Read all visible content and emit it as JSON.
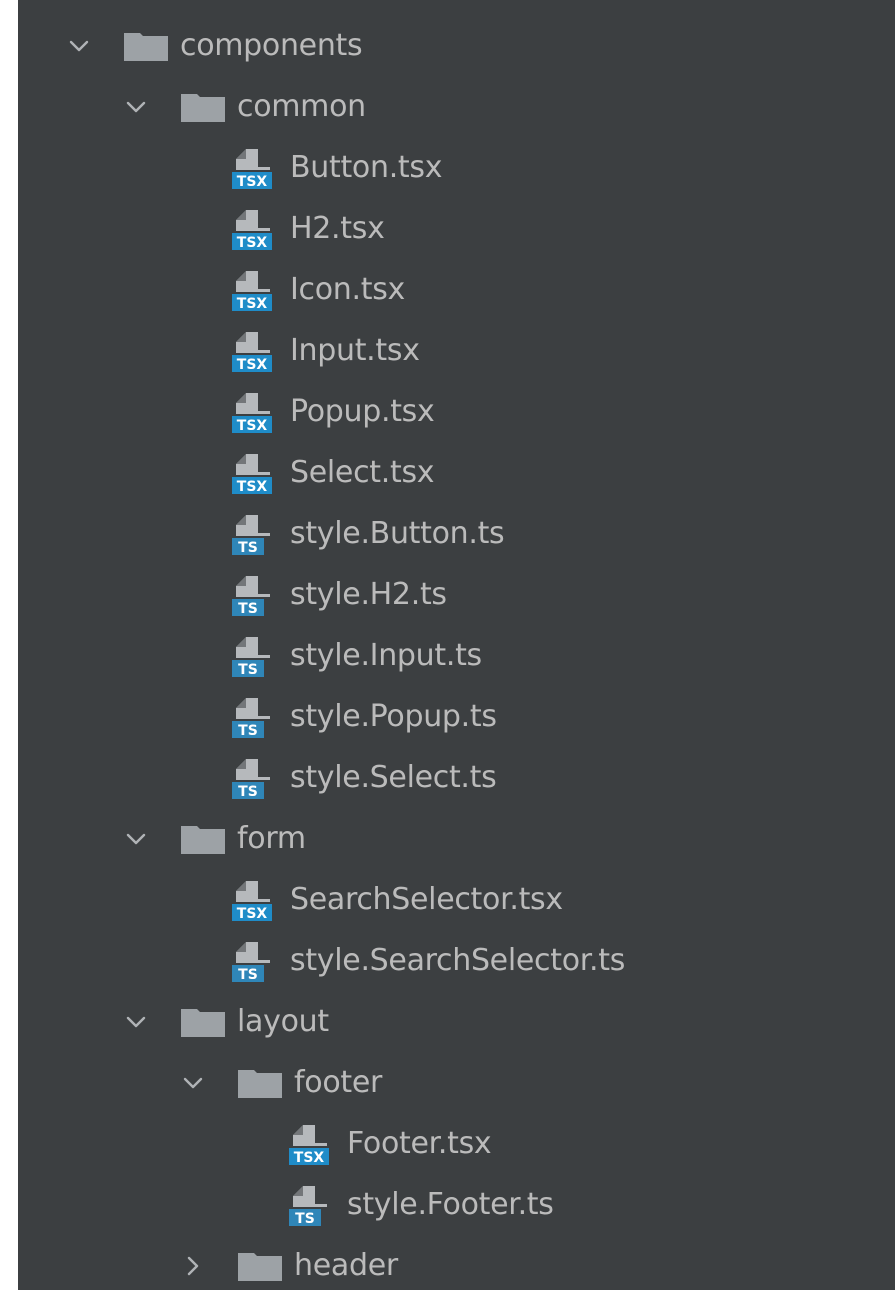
{
  "tree": [
    {
      "name": "components",
      "type": "folder",
      "depth": 0,
      "expanded": true
    },
    {
      "name": "common",
      "type": "folder",
      "depth": 1,
      "expanded": true
    },
    {
      "name": "Button.tsx",
      "type": "file",
      "depth": 2,
      "badge": "TSX"
    },
    {
      "name": "H2.tsx",
      "type": "file",
      "depth": 2,
      "badge": "TSX"
    },
    {
      "name": "Icon.tsx",
      "type": "file",
      "depth": 2,
      "badge": "TSX"
    },
    {
      "name": "Input.tsx",
      "type": "file",
      "depth": 2,
      "badge": "TSX"
    },
    {
      "name": "Popup.tsx",
      "type": "file",
      "depth": 2,
      "badge": "TSX"
    },
    {
      "name": "Select.tsx",
      "type": "file",
      "depth": 2,
      "badge": "TSX"
    },
    {
      "name": "style.Button.ts",
      "type": "file",
      "depth": 2,
      "badge": "TS"
    },
    {
      "name": "style.H2.ts",
      "type": "file",
      "depth": 2,
      "badge": "TS"
    },
    {
      "name": "style.Input.ts",
      "type": "file",
      "depth": 2,
      "badge": "TS"
    },
    {
      "name": "style.Popup.ts",
      "type": "file",
      "depth": 2,
      "badge": "TS"
    },
    {
      "name": "style.Select.ts",
      "type": "file",
      "depth": 2,
      "badge": "TS"
    },
    {
      "name": "form",
      "type": "folder",
      "depth": 1,
      "expanded": true
    },
    {
      "name": "SearchSelector.tsx",
      "type": "file",
      "depth": 2,
      "badge": "TSX"
    },
    {
      "name": "style.SearchSelector.ts",
      "type": "file",
      "depth": 2,
      "badge": "TS"
    },
    {
      "name": "layout",
      "type": "folder",
      "depth": 1,
      "expanded": true
    },
    {
      "name": "footer",
      "type": "folder",
      "depth": 2,
      "expanded": true
    },
    {
      "name": "Footer.tsx",
      "type": "file",
      "depth": 3,
      "badge": "TSX"
    },
    {
      "name": "style.Footer.ts",
      "type": "file",
      "depth": 3,
      "badge": "TS"
    },
    {
      "name": "header",
      "type": "folder",
      "depth": 2,
      "expanded": false
    }
  ],
  "colors": {
    "panel_bg": "#3c3f41",
    "text": "#bbbbbb",
    "folder": "#9da2a6",
    "chevron": "#b0b3b6",
    "file_page": "#b6b9bc",
    "badge_tsx": "#1f8cc8",
    "badge_ts": "#2f86b8",
    "badge_text": "#ffffff"
  }
}
